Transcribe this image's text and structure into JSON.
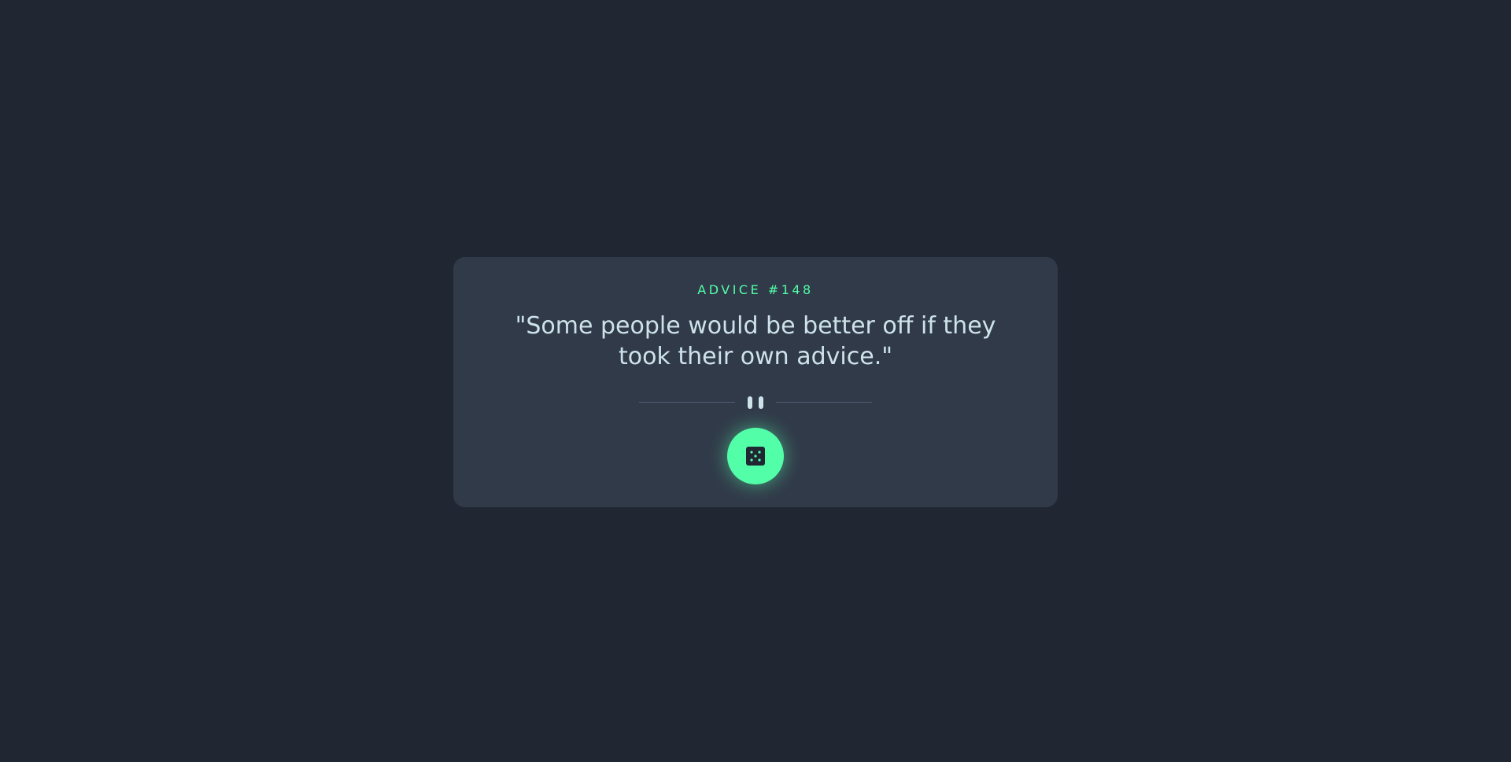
{
  "card": {
    "advice_label": "ADVICE #148",
    "quote": "\"Some people would be better off if they took their own advice.\""
  },
  "divider": {
    "icon": "pause-icon"
  },
  "button": {
    "icon": "dice-icon"
  },
  "colors": {
    "background": "#202733",
    "card": "#313A49",
    "accent": "#52FFA8",
    "text": "#CEE3E9",
    "divider": "#4F5D74"
  }
}
